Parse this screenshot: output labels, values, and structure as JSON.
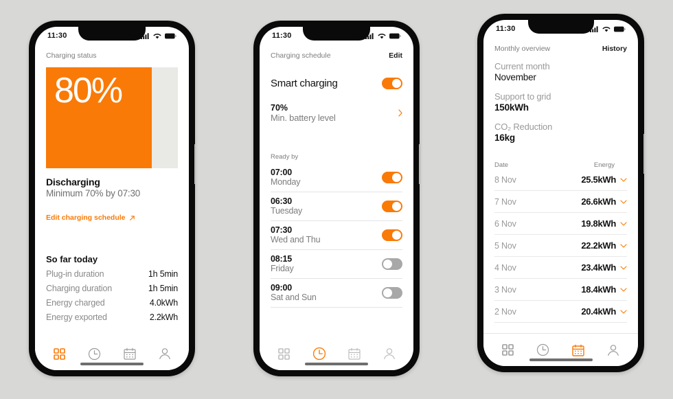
{
  "app": {
    "accent": "#f97a07",
    "track": "#e9e9e5",
    "muted": "#8a8a8a",
    "background": "#d8d8d6"
  },
  "statusbar": {
    "time": "11:30",
    "icons": [
      "signal-icon",
      "wifi-icon",
      "battery-icon"
    ]
  },
  "phone1": {
    "header": {
      "title": "Charging status"
    },
    "gauge": {
      "value": "80%",
      "percent": 80
    },
    "status": {
      "title": "Discharging",
      "subtitle": "Minimum 70% by 07:30"
    },
    "link": {
      "label": "Edit charging schedule",
      "icon": "arrow-up-right-icon"
    },
    "summary": {
      "title": "So far today",
      "rows": [
        {
          "label": "Plug-in duration",
          "value": "1h 5min"
        },
        {
          "label": "Charging duration",
          "value": "1h 5min"
        },
        {
          "label": "Energy charged",
          "value": "4.0kWh"
        },
        {
          "label": "Energy exported",
          "value": "2.2kWh"
        }
      ]
    },
    "nav": {
      "items": [
        {
          "name": "grid-icon",
          "active": true
        },
        {
          "name": "clock-icon",
          "active": false
        },
        {
          "name": "calendar-icon",
          "active": false
        },
        {
          "name": "person-icon",
          "active": false
        }
      ]
    }
  },
  "phone2": {
    "header": {
      "title": "Charging schedule",
      "action": "Edit"
    },
    "smart_charging": {
      "label": "Smart charging",
      "enabled": true
    },
    "min_battery": {
      "value": "70%",
      "label": "Min. battery level",
      "chevron": "chevron-right-icon"
    },
    "ready_by_label": "Ready by",
    "schedules": [
      {
        "time": "07:00",
        "days": "Monday",
        "enabled": true
      },
      {
        "time": "06:30",
        "days": "Tuesday",
        "enabled": true
      },
      {
        "time": "07:30",
        "days": "Wed and Thu",
        "enabled": true
      },
      {
        "time": "08:15",
        "days": "Friday",
        "enabled": false
      },
      {
        "time": "09:00",
        "days": "Sat and Sun",
        "enabled": false
      }
    ],
    "nav": {
      "items": [
        {
          "name": "grid-icon",
          "active": false
        },
        {
          "name": "clock-icon",
          "active": true
        },
        {
          "name": "calendar-icon",
          "active": false
        },
        {
          "name": "person-icon",
          "active": false
        }
      ]
    }
  },
  "phone3": {
    "header": {
      "title": "Monthly overview",
      "action": "History"
    },
    "overview": [
      {
        "label": "Current month",
        "value": "November"
      },
      {
        "label": "Support to grid",
        "value": "150kWh"
      },
      {
        "label": "CO₂ Reduction",
        "value": "16kg"
      }
    ],
    "table": {
      "columns": {
        "date": "Date",
        "energy": "Energy"
      },
      "rows": [
        {
          "date": "8 Nov",
          "energy": "25.5kWh"
        },
        {
          "date": "7 Nov",
          "energy": "26.6kWh"
        },
        {
          "date": "6 Nov",
          "energy": "19.8kWh"
        },
        {
          "date": "5 Nov",
          "energy": "22.2kWh"
        },
        {
          "date": "4 Nov",
          "energy": "23.4kWh"
        },
        {
          "date": "3 Nov",
          "energy": "18.4kWh"
        },
        {
          "date": "2 Nov",
          "energy": "20.4kWh"
        }
      ]
    },
    "nav": {
      "items": [
        {
          "name": "grid-icon",
          "active": false
        },
        {
          "name": "clock-icon",
          "active": false
        },
        {
          "name": "calendar-icon",
          "active": true
        },
        {
          "name": "person-icon",
          "active": false
        }
      ]
    }
  }
}
